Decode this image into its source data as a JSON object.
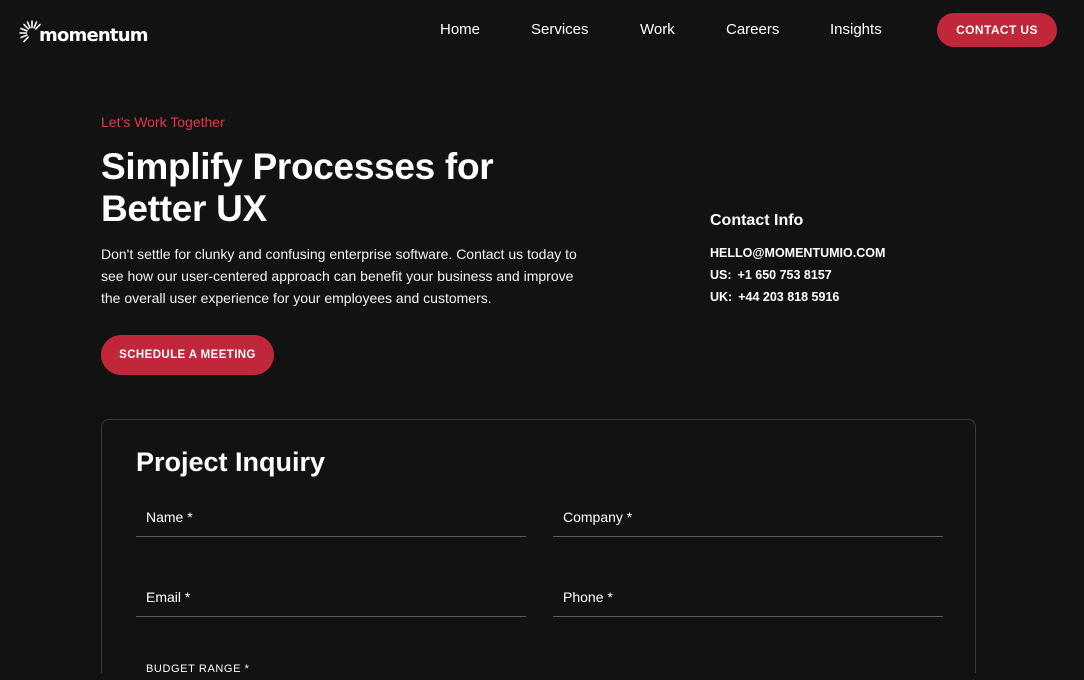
{
  "brand": {
    "name": "momentum",
    "accent": "#c1273a"
  },
  "nav": {
    "items": [
      "Home",
      "Services",
      "Work",
      "Careers",
      "Insights"
    ],
    "cta": "CONTACT US"
  },
  "hero": {
    "eyebrow": "Let’s Work Together",
    "title": "Simplify Processes for Better UX",
    "description": "Don't settle for clunky and confusing enterprise software. Contact us today to see how our user-centered approach can benefit your business and improve the overall user experience for your employees and customers.",
    "cta": "SCHEDULE A MEETING"
  },
  "contact_info": {
    "title": "Contact Info",
    "email": "HELLO@MOMENTUMIO.COM",
    "us_label": "US:",
    "us_phone": "+1 650 753 8157",
    "uk_label": "UK:",
    "uk_phone": "+44 203 818 5916"
  },
  "inquiry": {
    "title": "Project Inquiry",
    "fields": {
      "name": "Name *",
      "company": "Company *",
      "email": "Email *",
      "phone": "Phone *"
    },
    "budget_label": "BUDGET RANGE *"
  }
}
